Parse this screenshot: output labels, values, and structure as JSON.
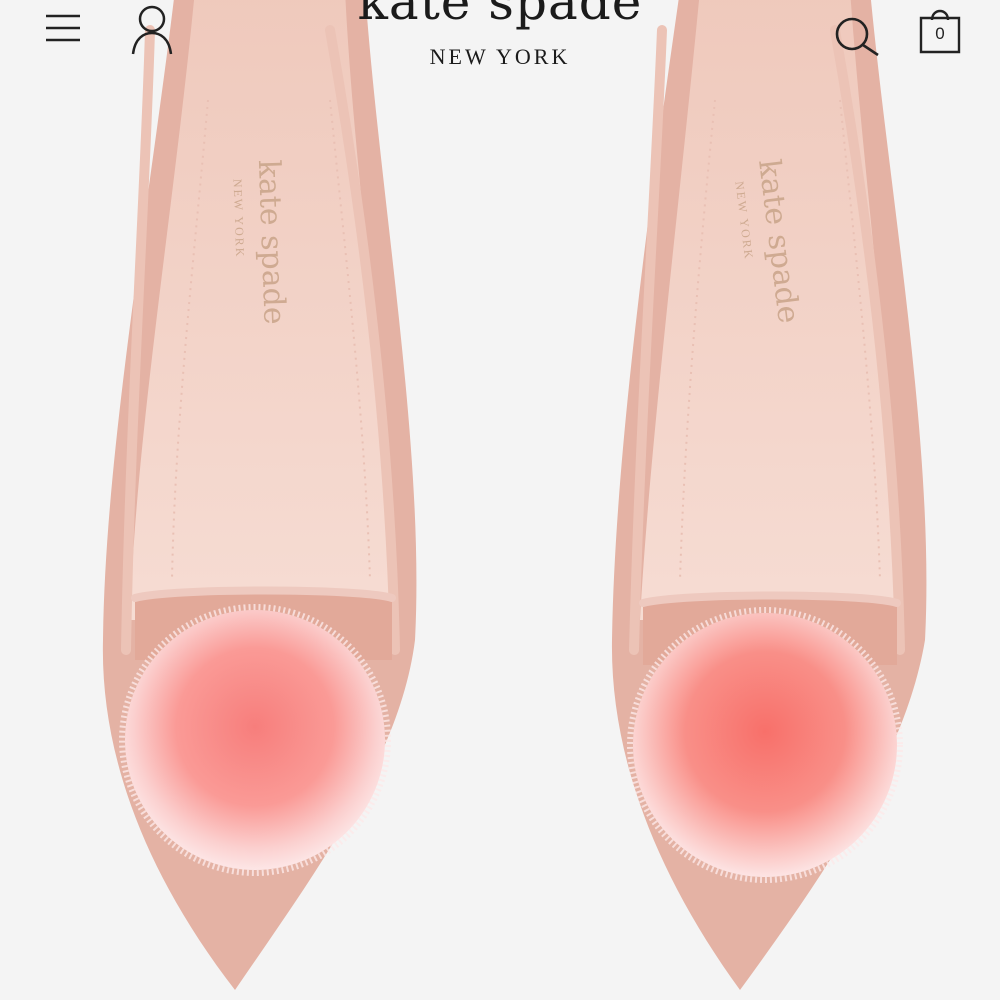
{
  "header": {
    "brand_name": "kate spade",
    "brand_sub": "NEW YORK",
    "cart_count": "0",
    "icons": [
      "menu-icon",
      "account-icon",
      "search-icon",
      "bag-icon"
    ]
  },
  "product": {
    "insole_brand": "kate spade",
    "insole_sub": "NEW YORK",
    "colors": {
      "shoe": "#e4b2a4",
      "lining": "#f3d6cb",
      "pompom": "#f88f89"
    }
  }
}
